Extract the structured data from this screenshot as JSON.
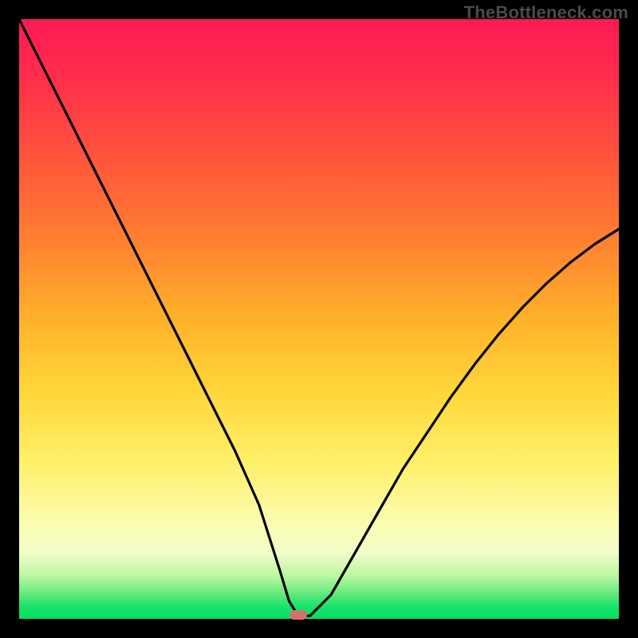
{
  "watermark": "TheBottleneck.com",
  "chart_data": {
    "type": "line",
    "title": "",
    "xlabel": "",
    "ylabel": "",
    "xlim": [
      0,
      100
    ],
    "ylim": [
      0,
      100
    ],
    "grid": false,
    "series": [
      {
        "name": "bottleneck-curve",
        "x": [
          0,
          4,
          8,
          12,
          16,
          20,
          24,
          28,
          32,
          36,
          40,
          43.5,
          45,
          46.5,
          48.5,
          52,
          56,
          60,
          64,
          68,
          72,
          76,
          80,
          84,
          88,
          92,
          96,
          100
        ],
        "y": [
          100,
          92,
          84,
          76,
          68,
          60,
          52,
          44,
          36,
          28,
          19,
          8,
          3,
          0.5,
          0.5,
          4,
          11,
          18,
          25,
          31,
          37,
          42.5,
          47.5,
          52,
          56,
          59.5,
          62.5,
          65
        ]
      }
    ],
    "marker": {
      "x": 46.5,
      "y": 0.6,
      "color": "#d4716f"
    },
    "gradient_stops": [
      {
        "pos": 0.0,
        "color": "#ff1a55"
      },
      {
        "pos": 0.5,
        "color": "#ffb12a"
      },
      {
        "pos": 0.84,
        "color": "#fbfcb0"
      },
      {
        "pos": 1.0,
        "color": "#04df63"
      }
    ]
  }
}
